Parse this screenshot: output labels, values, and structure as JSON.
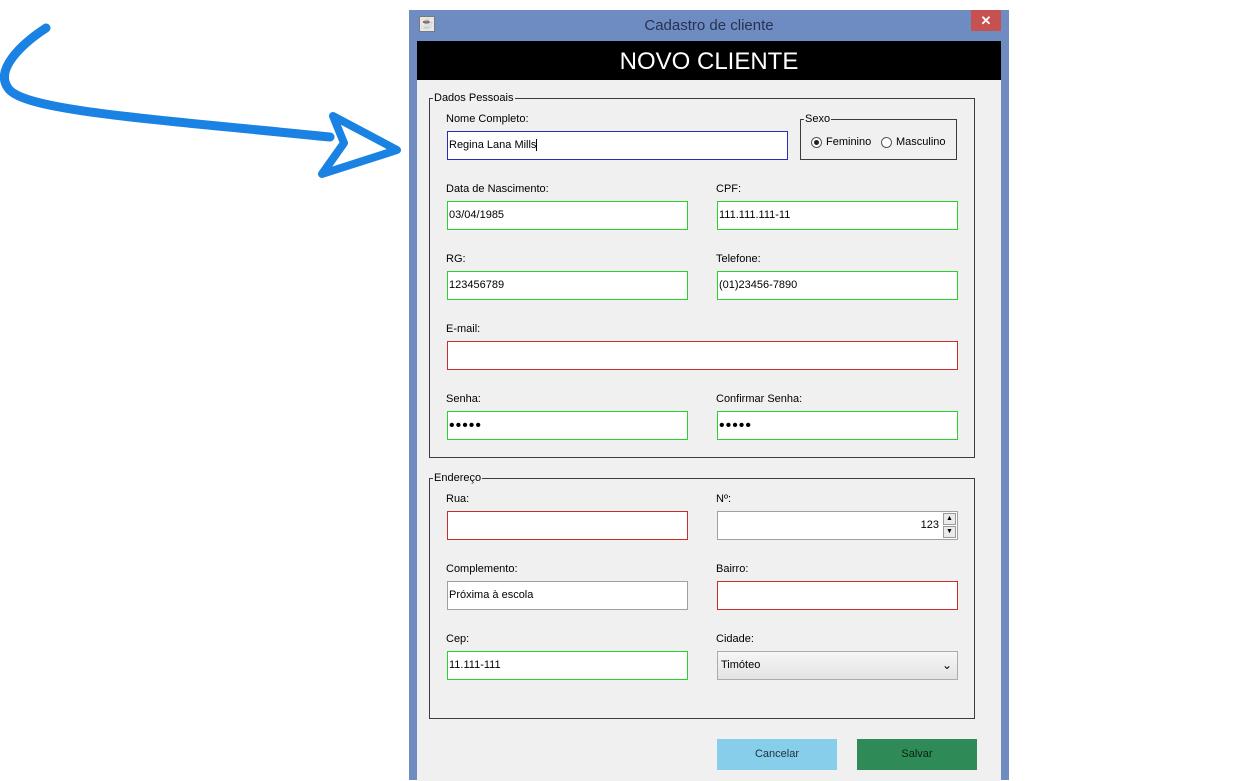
{
  "window": {
    "title": "Cadastro de cliente",
    "close_glyph": "✕",
    "app_icon": "java-cup-icon"
  },
  "banner": {
    "title": "NOVO CLIENTE"
  },
  "dados_pessoais": {
    "legend": "Dados Pessoais",
    "nome": {
      "label": "Nome Completo:",
      "value": "Regina Lana Mills"
    },
    "sexo": {
      "legend": "Sexo",
      "options": [
        {
          "label": "Feminino",
          "checked": true
        },
        {
          "label": "Masculino",
          "checked": false
        }
      ]
    },
    "nascimento": {
      "label": "Data de Nascimento:",
      "value": "03/04/1985"
    },
    "cpf": {
      "label": "CPF:",
      "value": "111.111.111-11"
    },
    "rg": {
      "label": "RG:",
      "value": "123456789"
    },
    "telefone": {
      "label": "Telefone:",
      "value": "(01)23456-7890"
    },
    "email": {
      "label": "E-mail:",
      "value": ""
    },
    "senha": {
      "label": "Senha:",
      "value": "•••••"
    },
    "confirmar_senha": {
      "label": "Confirmar Senha:",
      "value": "•••••"
    }
  },
  "endereco": {
    "legend": "Endereço",
    "rua": {
      "label": "Rua:",
      "value": ""
    },
    "numero": {
      "label": "Nº:",
      "value": "123"
    },
    "complemento": {
      "label": "Complemento:",
      "value": "Próxima à escola"
    },
    "bairro": {
      "label": "Bairro:",
      "value": ""
    },
    "cep": {
      "label": "Cep:",
      "value": "11.111-111"
    },
    "cidade": {
      "label": "Cidade:",
      "value": "Timóteo"
    }
  },
  "buttons": {
    "cancel": "Cancelar",
    "save": "Salvar"
  },
  "colors": {
    "valid_border": "#2bd12b",
    "invalid_border": "#cc2b2b",
    "focus_border": "#2b2bb4",
    "cancel_bg": "#87ceeb",
    "save_bg": "#2e8b57",
    "arrow": "#1a82e2",
    "window_frame": "#6f8cc2"
  }
}
